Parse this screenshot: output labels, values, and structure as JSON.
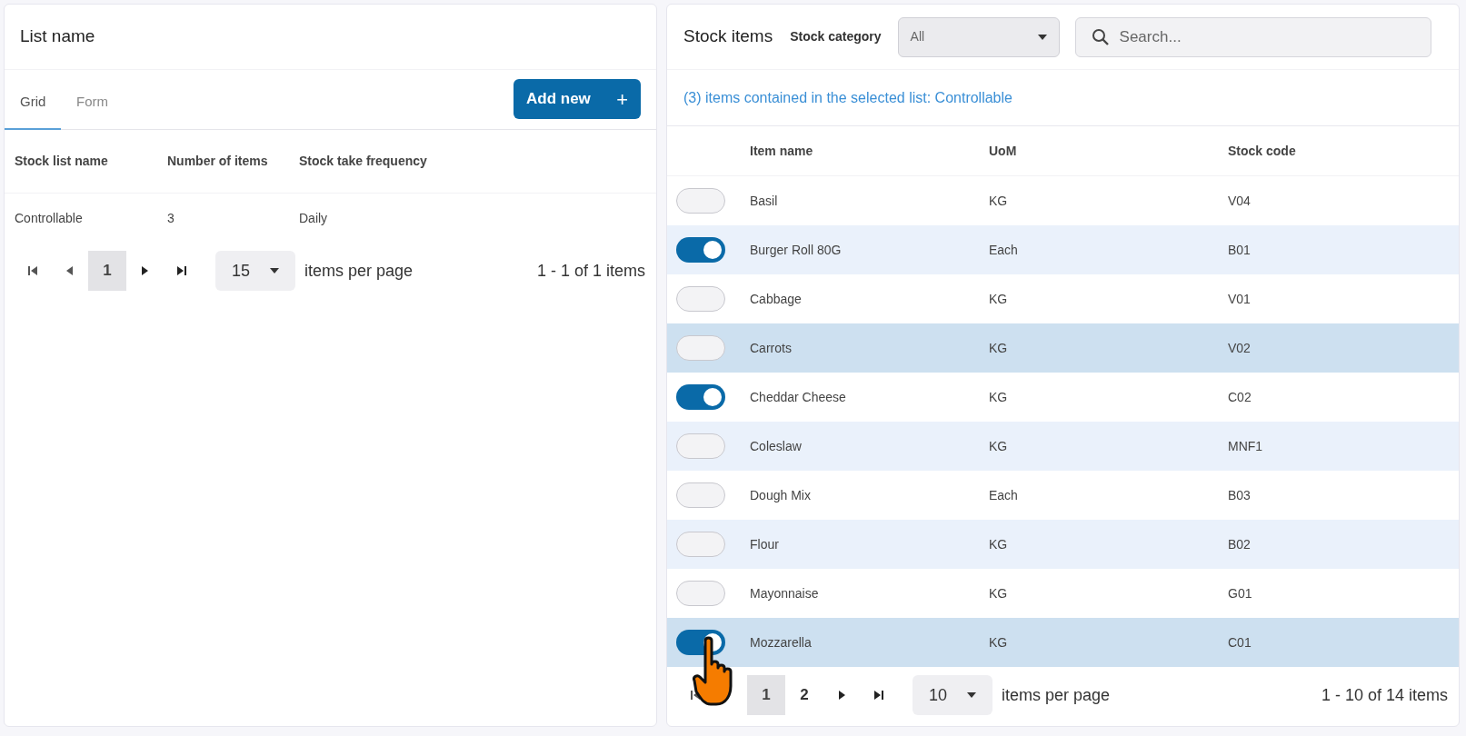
{
  "left_panel": {
    "title": "List name",
    "tabs": [
      {
        "label": "Grid",
        "selected": true
      },
      {
        "label": "Form",
        "selected": false
      }
    ],
    "add_button": {
      "label": "Add new",
      "icon": "+"
    },
    "table": {
      "columns": [
        "Stock list name",
        "Number of items",
        "Stock take frequency"
      ],
      "rows": [
        {
          "cells": [
            "Controllable",
            "3",
            "Daily"
          ]
        }
      ]
    },
    "pager": {
      "pages": [
        {
          "label": "1",
          "selected": true
        }
      ],
      "page_size": "15",
      "page_size_label": "items per page",
      "summary": "1 - 1 of 1 items"
    }
  },
  "right_panel": {
    "title": "Stock items",
    "category_label": "Stock category",
    "category_value": "All",
    "search_placeholder": "Search...",
    "info": "(3) items contained in the selected list: Controllable",
    "table": {
      "columns": [
        "Item name",
        "UoM",
        "Stock code"
      ],
      "rows": [
        {
          "on": false,
          "highlighted": false,
          "cells": [
            "Basil",
            "KG",
            "V04"
          ]
        },
        {
          "on": true,
          "highlighted": false,
          "cells": [
            "Burger Roll 80G",
            "Each",
            "B01"
          ]
        },
        {
          "on": false,
          "highlighted": false,
          "cells": [
            "Cabbage",
            "KG",
            "V01"
          ]
        },
        {
          "on": false,
          "highlighted": true,
          "cells": [
            "Carrots",
            "KG",
            "V02"
          ]
        },
        {
          "on": true,
          "highlighted": false,
          "cells": [
            "Cheddar Cheese",
            "KG",
            "C02"
          ]
        },
        {
          "on": false,
          "highlighted": false,
          "cells": [
            "Coleslaw",
            "KG",
            "MNF1"
          ]
        },
        {
          "on": false,
          "highlighted": false,
          "cells": [
            "Dough Mix",
            "Each",
            "B03"
          ]
        },
        {
          "on": false,
          "highlighted": false,
          "cells": [
            "Flour",
            "KG",
            "B02"
          ]
        },
        {
          "on": false,
          "highlighted": false,
          "cells": [
            "Mayonnaise",
            "KG",
            "G01"
          ]
        },
        {
          "on": true,
          "highlighted": true,
          "cells": [
            "Mozzarella",
            "KG",
            "C01"
          ]
        }
      ]
    },
    "pager": {
      "pages": [
        {
          "label": "1",
          "selected": true
        },
        {
          "label": "2",
          "selected": false
        }
      ],
      "page_size": "10",
      "page_size_label": "items per page",
      "summary": "1 - 10 of 14 items"
    }
  }
}
